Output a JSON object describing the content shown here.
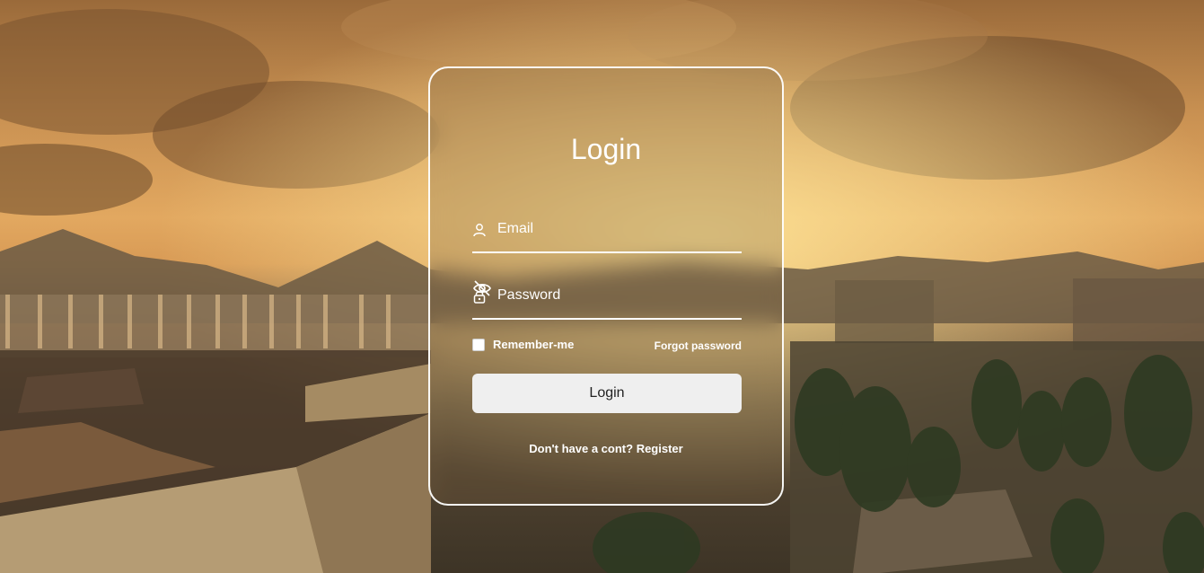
{
  "form": {
    "title": "Login",
    "email_placeholder": "Email",
    "password_placeholder": "Password",
    "remember_label": "Remember-me",
    "forgot_label": "Forgot password",
    "login_label": "Login",
    "register_prefix": "Don't have a cont?",
    "register_link": "Register"
  },
  "colors": {
    "card_border": "#ffffff",
    "button_bg": "#efefef",
    "text": "#ffffff"
  },
  "icons": {
    "email": "user-icon",
    "password": "lock-icon",
    "toggle": "eye-slash-icon"
  }
}
